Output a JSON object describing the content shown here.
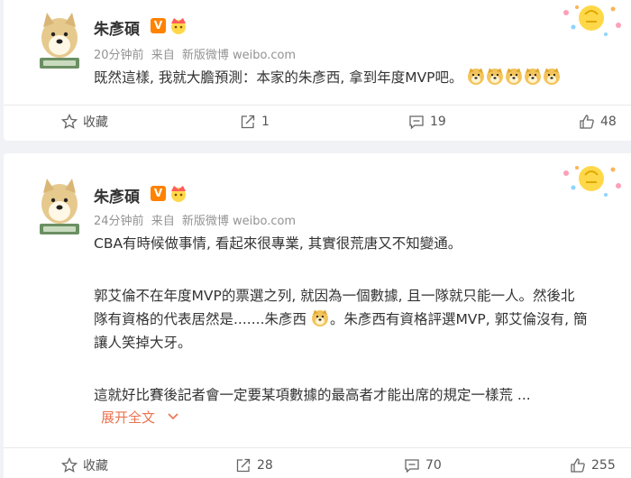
{
  "posts": [
    {
      "author": "朱彥碩",
      "verified_mark": "V",
      "time": "20分钟前",
      "source_prefix": "来自",
      "source": "新版微博 weibo.com",
      "lines": [
        "既然這樣, 我就大膽預測：本家的朱彥西, 拿到年度MVP吧。"
      ],
      "emoji_count": 5,
      "actions": {
        "favorite_label": "收藏",
        "repost_count": "1",
        "comment_count": "19",
        "like_count": "48"
      }
    },
    {
      "author": "朱彥碩",
      "verified_mark": "V",
      "time": "24分钟前",
      "source_prefix": "来自",
      "source": "新版微博 weibo.com",
      "lines": [
        "CBA有時候做事情, 看起來很專業, 其實很荒唐又不知變通。",
        "郭艾倫不在年度MVP的票選之列, 就因為一個數據, 且一隊就只能一人。然後北",
        "隊有資格的代表居然是.......朱彥西",
        "。朱彥西有資格評選MVP, 郭艾倫沒有, 簡",
        "讓人笑掉大牙。",
        "這就好比賽後記者會一定要某項數據的最高者才能出席的規定一樣荒 ..."
      ],
      "expand_label": "展开全文",
      "actions": {
        "favorite_label": "收藏",
        "repost_count": "28",
        "comment_count": "70",
        "like_count": "255"
      }
    }
  ],
  "colors": {
    "accent": "#eb7350",
    "verified": "#ff8200",
    "meta": "#939393",
    "background": "#f1f2f5"
  },
  "icons": [
    "doge-avatar",
    "verified-icon",
    "crown-icon",
    "decoration-icon",
    "doge-emoji",
    "star-icon",
    "repost-icon",
    "comment-icon",
    "like-icon",
    "chevron-down-icon"
  ]
}
